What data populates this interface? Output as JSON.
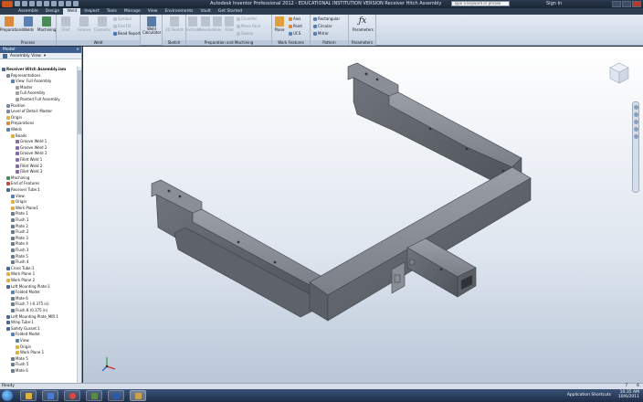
{
  "title": "Autodesk Inventor Professional 2012 - EDUCATIONAL INSTITUTION VERSION  Receiver Hitch Assembly",
  "search_placeholder": "Type a keyword or phrase",
  "signin": "Sign In",
  "tabs": [
    "Assemble",
    "Design",
    "Weld",
    "Inspect",
    "Tools",
    "Manage",
    "View",
    "Environments",
    "Vault",
    "Get Started"
  ],
  "ribbon": {
    "process": {
      "name": "Process",
      "buttons": [
        "Preparations",
        "Welds",
        "Machining"
      ]
    },
    "weld": {
      "name": "Weld",
      "buttons": [
        "Fillet",
        "Groove",
        "Cosmetic"
      ],
      "small": [
        "Symbol",
        "End Fill",
        "Bead Report"
      ]
    },
    "weldcalc": {
      "label": "Weld Calculator"
    },
    "sketch": {
      "name": "Sketch",
      "buttons": [
        "2D Sketch"
      ]
    },
    "prep": {
      "name": "Preparation and Machining",
      "buttons": [
        "Extrude",
        "Revolve",
        "Hole",
        "Fillet",
        "Chamfer",
        "Move Face",
        "Sweep"
      ]
    },
    "work": {
      "name": "Work Features",
      "plane": "Plane",
      "small": [
        "Axis",
        "Point",
        "UCS"
      ]
    },
    "pattern": {
      "name": "Pattern",
      "small": [
        "Rectangular",
        "Circular",
        "Mirror"
      ]
    },
    "params": {
      "name": "Parameters",
      "label": "Parameters"
    }
  },
  "browser": {
    "header": "Model",
    "view": "Assembly View",
    "items": [
      "Receiver Hitch Assembly.iam",
      "Representations",
      "View: Full Assembly",
      "Master",
      "Full Assembly",
      "Painted Full Assembly",
      "Position",
      "Level of Detail: Master",
      "Origin",
      "Preparations",
      "Welds",
      "Beads",
      "Groove Weld 1",
      "Groove Weld 2",
      "Groove Weld 3",
      "Fillet Weld 1",
      "Fillet Weld 2",
      "Fillet Weld 3",
      "Machining",
      "End of Features",
      "Receiver Tube:1",
      "View:",
      "Origin",
      "Work Plane1",
      "Plate 1",
      "Flush 1",
      "Plate 2",
      "Flush 2",
      "Plate 3",
      "Plate 4",
      "Flush 3",
      "Plate 5",
      "Flush 4",
      "Cross Tube:1",
      "Work Plane 1",
      "Work Plane 2",
      "Left Mounting Plate:1",
      "Folded Model",
      "Mate 6",
      "Flush 7 (-0.375 in)",
      "Flush 8 (0.375 in)",
      "Left Mounting Plate_MIR:1",
      "Wrap Tube:1",
      "Safety Gusset:1",
      "Folded Model",
      "View:",
      "Origin",
      "Work Plane 1",
      "Mate 5",
      "Flush 5",
      "Mate 6"
    ]
  },
  "status": {
    "text": "Ready",
    "n1": "7",
    "n2": "6"
  },
  "taskbar": {
    "shortcuts": "Application Shortcuts",
    "time": "10:35 AM",
    "date": "10/6/2011"
  },
  "colors": {
    "accent": "#3d5e8c",
    "part": "#7c7f86"
  }
}
